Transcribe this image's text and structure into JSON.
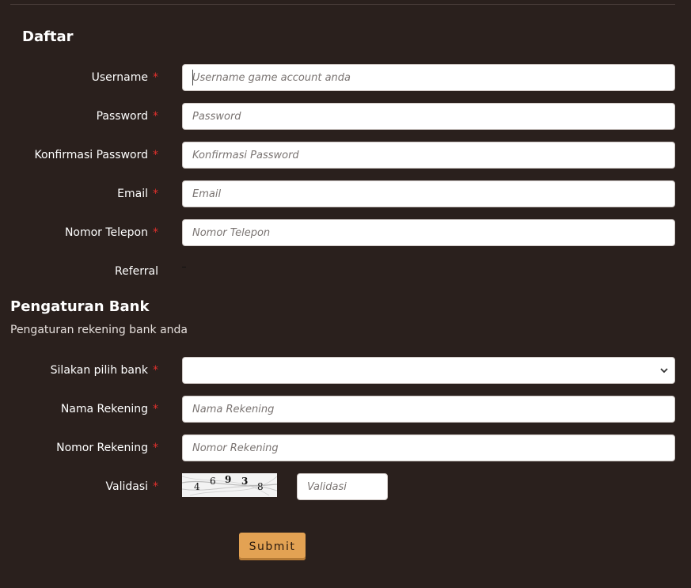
{
  "registration": {
    "title": "Daftar",
    "fields": [
      {
        "label": "Username",
        "placeholder": "Username game account anda",
        "required": "*"
      },
      {
        "label": "Password",
        "placeholder": "Password",
        "required": "*"
      },
      {
        "label": "Konfirmasi Password",
        "placeholder": "Konfirmasi Password",
        "required": "*"
      },
      {
        "label": "Email",
        "placeholder": "Email",
        "required": "*"
      },
      {
        "label": "Nomor Telepon",
        "placeholder": "Nomor Telepon",
        "required": "*"
      }
    ],
    "referral_label": "Referral"
  },
  "bank": {
    "title": "Pengaturan Bank",
    "subtitle": "Pengaturan rekening bank anda",
    "bank_select_label": "Silakan pilih bank",
    "bank_select_value": "",
    "account_name": {
      "label": "Nama Rekening",
      "placeholder": "Nama Rekening",
      "required": "*"
    },
    "account_number": {
      "label": "Nomor Rekening",
      "placeholder": "Nomor Rekening",
      "required": "*"
    },
    "required_mark": "*"
  },
  "validation": {
    "label": "Validasi",
    "required": "*",
    "captcha_digits": [
      "4",
      "6",
      "9",
      "3",
      "8"
    ],
    "placeholder": "Validasi"
  },
  "submit_label": "Submit",
  "colors": {
    "background": "#2a201d",
    "required": "#e0312d",
    "submit_bg": "#e3a253"
  }
}
